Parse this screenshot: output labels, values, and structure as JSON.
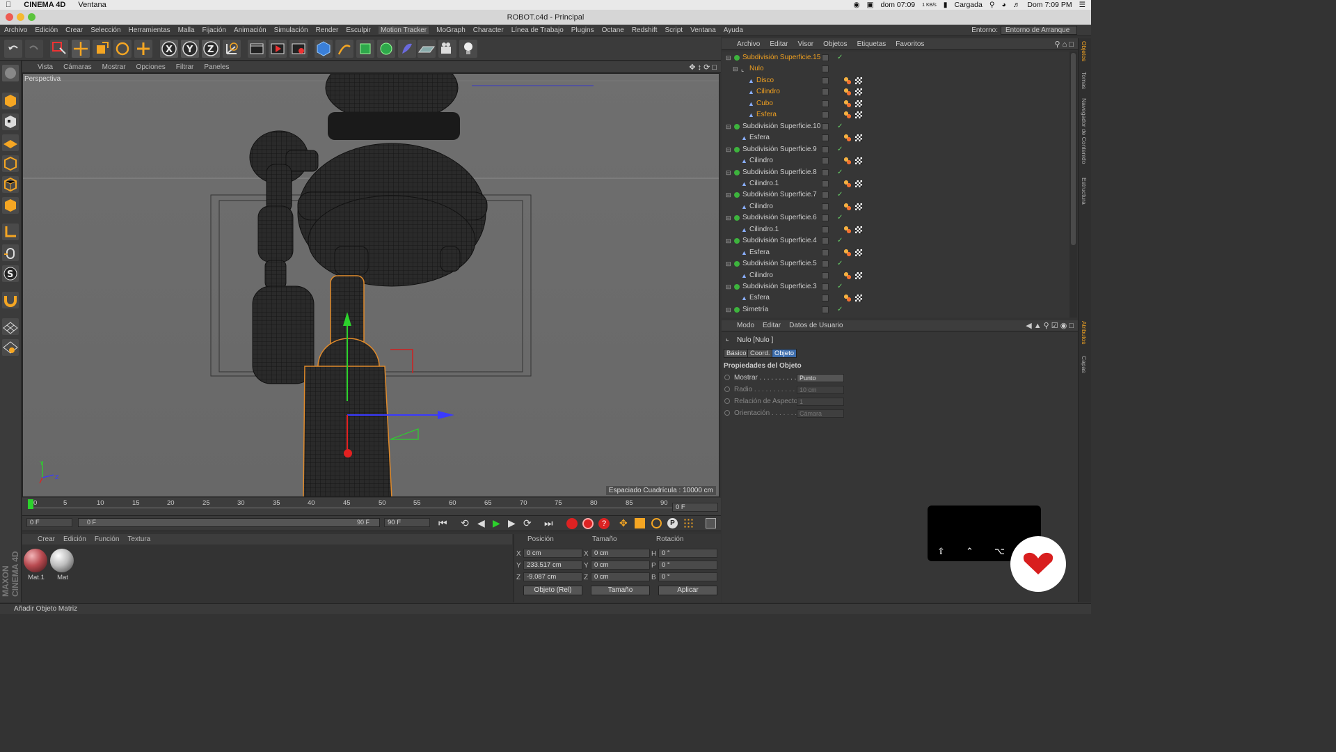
{
  "mac_menubar": {
    "app": "CINEMA 4D",
    "menu": "Ventana",
    "clock1": "dom 07:09",
    "battery": "Cargada",
    "clock2": "Dom 7:09 PM",
    "net": "1 KB/s"
  },
  "window": {
    "title": "ROBOT.c4d - Principal"
  },
  "app_menu": [
    "Archivo",
    "Edición",
    "Crear",
    "Selección",
    "Herramientas",
    "Malla",
    "Fijación",
    "Animación",
    "Simulación",
    "Render",
    "Esculpir",
    "Motion Tracker",
    "MoGraph",
    "Character",
    "Línea de Trabajo",
    "Plugins",
    "Octane",
    "Redshift",
    "Script",
    "Ventana",
    "Ayuda"
  ],
  "env": {
    "label": "Entorno:",
    "value": "Entorno de Arranque"
  },
  "toolbar_icons": [
    "undo-icon",
    "redo-icon",
    "select-icon",
    "move-icon",
    "scale-icon",
    "rotate-icon",
    "add-icon",
    "x-axis-icon",
    "y-axis-icon",
    "z-axis-icon",
    "world-coord-icon",
    "render-view-icon",
    "render-picture-icon",
    "render-settings-icon",
    "cube-icon",
    "pen-icon",
    "subdivision-icon",
    "array-icon",
    "deformer-icon",
    "floor-icon",
    "camera-icon",
    "light-icon"
  ],
  "viewport": {
    "menu": [
      "Vista",
      "Cámaras",
      "Mostrar",
      "Opciones",
      "Filtrar",
      "Paneles"
    ],
    "label": "Perspectiva",
    "grid": "Espaciado Cuadrícula : 10000 cm"
  },
  "timeline": {
    "ticks": [
      "0",
      "5",
      "10",
      "15",
      "20",
      "25",
      "30",
      "35",
      "40",
      "45",
      "50",
      "55",
      "60",
      "65",
      "70",
      "75",
      "80",
      "85",
      "90"
    ],
    "current": "0 F",
    "start": "0 F",
    "range_start": "0 F",
    "range_end": "90 F",
    "end": "90 F"
  },
  "materials": {
    "menu": [
      "Crear",
      "Edición",
      "Función",
      "Textura"
    ],
    "items": [
      {
        "name": "Mat.1",
        "color": "#b84a50"
      },
      {
        "name": "Mat",
        "color": "#bdbdbd"
      }
    ]
  },
  "coords": {
    "headers": [
      "Posición",
      "Tamaño",
      "Rotación"
    ],
    "pos": [
      {
        "axis": "X",
        "value": "0 cm"
      },
      {
        "axis": "Y",
        "value": "233.517 cm"
      },
      {
        "axis": "Z",
        "value": "-9.087 cm"
      }
    ],
    "size": [
      {
        "axis": "X",
        "value": "0 cm"
      },
      {
        "axis": "Y",
        "value": "0 cm"
      },
      {
        "axis": "Z",
        "value": "0 cm"
      }
    ],
    "rot": [
      {
        "axis": "H",
        "value": "0 °"
      },
      {
        "axis": "P",
        "value": "0 °"
      },
      {
        "axis": "B",
        "value": "0 °"
      }
    ],
    "mode": "Objeto (Rel)",
    "size_mode": "Tamaño",
    "apply": "Aplicar"
  },
  "status": "Añadir Objeto Matriz",
  "object_manager": {
    "menu": [
      "Archivo",
      "Editar",
      "Visor",
      "Objetos",
      "Etiquetas",
      "Favoritos"
    ],
    "rows": [
      {
        "name": "Subdivisión Superficie.15",
        "indent": 0,
        "type": "sds",
        "sel": true
      },
      {
        "name": "Nulo",
        "indent": 1,
        "type": "null",
        "sel": true
      },
      {
        "name": "Disco",
        "indent": 2,
        "type": "prim",
        "sel": true
      },
      {
        "name": "Cilindro",
        "indent": 2,
        "type": "prim",
        "sel": true
      },
      {
        "name": "Cubo",
        "indent": 2,
        "type": "prim",
        "sel": true
      },
      {
        "name": "Esfera",
        "indent": 2,
        "type": "prim",
        "sel": true
      },
      {
        "name": "Subdivisión Superficie.10",
        "indent": 0,
        "type": "sds"
      },
      {
        "name": "Esfera",
        "indent": 1,
        "type": "prim"
      },
      {
        "name": "Subdivisión Superficie.9",
        "indent": 0,
        "type": "sds"
      },
      {
        "name": "Cilindro",
        "indent": 1,
        "type": "prim"
      },
      {
        "name": "Subdivisión Superficie.8",
        "indent": 0,
        "type": "sds"
      },
      {
        "name": "Cilindro.1",
        "indent": 1,
        "type": "prim"
      },
      {
        "name": "Subdivisión Superficie.7",
        "indent": 0,
        "type": "sds"
      },
      {
        "name": "Cilindro",
        "indent": 1,
        "type": "prim"
      },
      {
        "name": "Subdivisión Superficie.6",
        "indent": 0,
        "type": "sds"
      },
      {
        "name": "Cilindro.1",
        "indent": 1,
        "type": "prim"
      },
      {
        "name": "Subdivisión Superficie.4",
        "indent": 0,
        "type": "sds"
      },
      {
        "name": "Esfera",
        "indent": 1,
        "type": "prim"
      },
      {
        "name": "Subdivisión Superficie.5",
        "indent": 0,
        "type": "sds"
      },
      {
        "name": "Cilindro",
        "indent": 1,
        "type": "prim"
      },
      {
        "name": "Subdivisión Superficie.3",
        "indent": 0,
        "type": "sds"
      },
      {
        "name": "Esfera",
        "indent": 1,
        "type": "prim"
      },
      {
        "name": "Simetría",
        "indent": 0,
        "type": "sym"
      }
    ]
  },
  "side_tabs": [
    "Objetos",
    "Tomas",
    "Navegador de Contenido",
    "Estructura",
    "Atributos",
    "Capas"
  ],
  "attributes": {
    "menu": [
      "Modo",
      "Editar",
      "Datos de Usuario"
    ],
    "object": "Nulo [Nulo ]",
    "tabs": [
      "Básico",
      "Coord.",
      "Objeto"
    ],
    "active_tab": "Objeto",
    "section": "Propiedades del Objeto",
    "props": [
      {
        "label": "Mostrar . . . . . . . . . . .",
        "value": "Punto",
        "dim": false
      },
      {
        "label": "Radio . . . . . . . . . . . .",
        "value": "10 cm",
        "dim": true
      },
      {
        "label": "Relación de Aspecto",
        "value": "1",
        "dim": true
      },
      {
        "label": "Orientación . . . . . . .",
        "value": "Cámara",
        "dim": true
      }
    ]
  }
}
